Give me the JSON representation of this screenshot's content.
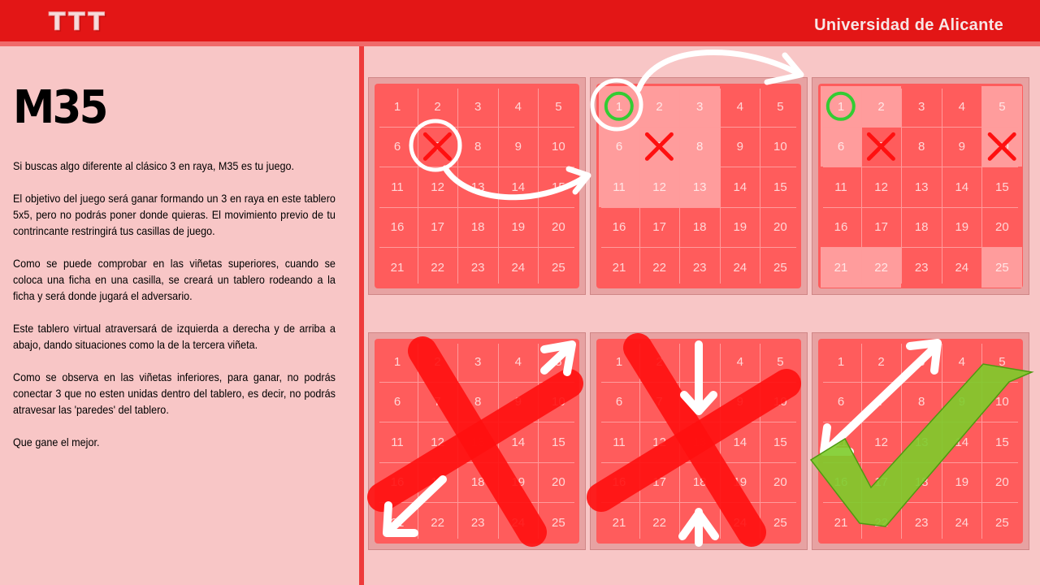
{
  "header": {
    "logo": "TTT",
    "university": "Universidad de Alicante"
  },
  "title": "M35",
  "paragraphs": [
    "Si buscas algo diferente al clásico 3 en raya, M35 es tu juego.",
    "El objetivo del juego será ganar formando un 3 en raya en este tablero 5x5, pero no podrás poner donde quieras. El movimiento previo de tu contrincante restringirá tus casillas de juego.",
    "Como se puede comprobar en las viñetas superiores, cuando se coloca una ficha en una casilla, se creará un tablero rodeando a la ficha y será donde jugará el adversario.",
    "Este tablero virtual atraversará de izquierda a derecha y de arriba a abajo, dando situaciones como la de la tercera viñeta.",
    "Como se observa en las viñetas inferiores, para ganar, no podrás conectar 3 que no esten unidas dentro del tablero, es decir, no podrás atravesar las 'paredes' del tablero.",
    "Que gane el mejor."
  ],
  "board_cells": [
    "1",
    "2",
    "3",
    "4",
    "5",
    "6",
    "7",
    "8",
    "9",
    "10",
    "11",
    "12",
    "13",
    "14",
    "15",
    "16",
    "17",
    "18",
    "19",
    "20",
    "21",
    "22",
    "23",
    "24",
    "25"
  ],
  "colors": {
    "header": "#e31616",
    "board": "#ff5c5c",
    "cross": "#ff1010",
    "circle": "#33cc33",
    "check": "#7dcc2a"
  },
  "panels": [
    {
      "id": "panel-1",
      "highlight": [],
      "crosses": [
        7
      ],
      "circles": [],
      "overlay": "ring-arrow"
    },
    {
      "id": "panel-2",
      "highlight": [
        1,
        2,
        3,
        6,
        7,
        8,
        11,
        12,
        13
      ],
      "crosses": [
        7
      ],
      "circles": [
        1
      ],
      "overlay": "ring-arrow-out"
    },
    {
      "id": "panel-3",
      "highlight": [
        1,
        2,
        5,
        6,
        10,
        21,
        22,
        25
      ],
      "crosses": [
        7,
        10
      ],
      "circles": [
        1
      ],
      "overlay": "none"
    },
    {
      "id": "panel-4",
      "highlight": [],
      "crosses": [],
      "circles": [],
      "overlay": "big-x-diagonal"
    },
    {
      "id": "panel-5",
      "highlight": [],
      "crosses": [],
      "circles": [],
      "overlay": "big-x-vertical"
    },
    {
      "id": "panel-6",
      "highlight": [],
      "crosses": [],
      "circles": [],
      "overlay": "check"
    }
  ]
}
